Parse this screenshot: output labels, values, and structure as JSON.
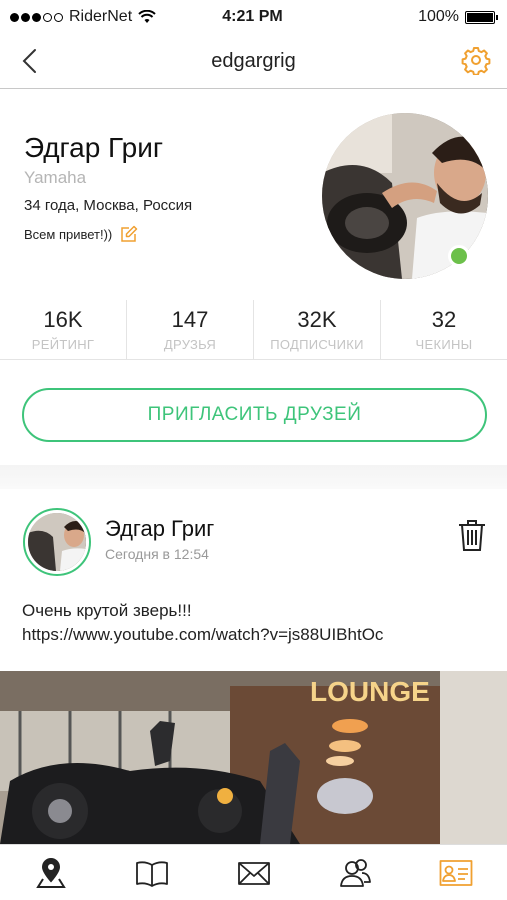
{
  "status_bar": {
    "carrier": "RiderNet",
    "time": "4:21 PM",
    "battery": "100%",
    "battery_level": 1.0
  },
  "nav": {
    "title": "edgargrig",
    "back_icon": "chevron-left-icon",
    "settings_icon": "gear-icon"
  },
  "profile": {
    "name": "Эдгар Григ",
    "bike": "Yamaha",
    "info": "34 года, Москва, Россия",
    "status": "Всем привет!))",
    "online": true
  },
  "stats": [
    {
      "value": "16K",
      "label": "РЕЙТИНГ"
    },
    {
      "value": "147",
      "label": "ДРУЗЬЯ"
    },
    {
      "value": "32K",
      "label": "ПОДПИСЧИКИ"
    },
    {
      "value": "32",
      "label": "ЧЕКИНЫ"
    }
  ],
  "invite_label": "ПРИГЛАСИТЬ ДРУЗЕЙ",
  "post": {
    "author": "Эдгар Григ",
    "time": "Сегодня в 12:54",
    "text_line1": "Очень крутой зверь!!!",
    "text_line2": "https://www.youtube.com/watch?v=js88UIBhtOc"
  },
  "tabs": [
    {
      "icon": "map-pin-icon",
      "active": false
    },
    {
      "icon": "book-icon",
      "active": false
    },
    {
      "icon": "mail-icon",
      "active": false
    },
    {
      "icon": "friends-icon",
      "active": false
    },
    {
      "icon": "profile-card-icon",
      "active": true
    }
  ],
  "colors": {
    "accent_green": "#3ec47a",
    "accent_orange": "#f0a030",
    "online_green": "#6cc04a"
  }
}
